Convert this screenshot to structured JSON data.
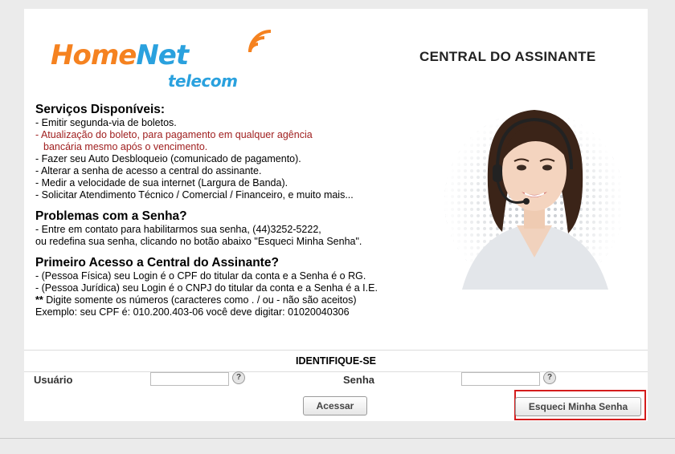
{
  "logo": {
    "word1": "Home",
    "word2": "Net",
    "sub": "telecom"
  },
  "header": {
    "title": "CENTRAL DO ASSINANTE"
  },
  "services": {
    "heading": "Serviços Disponíveis:",
    "items": [
      "- Emitir segunda-via de boletos.",
      "- Atualização do boleto, para pagamento em qualquer agência",
      "bancária mesmo após o vencimento.",
      "- Fazer seu Auto Desbloqueio (comunicado de pagamento).",
      "- Alterar a senha de acesso a central do assinante.",
      "- Medir a velocidade de sua internet (Largura de Banda).",
      "- Solicitar Atendimento Técnico / Comercial / Financeiro, e muito mais..."
    ]
  },
  "password_problems": {
    "heading": "Problemas com a Senha?",
    "lines": [
      "- Entre em contato para habilitarmos sua senha, (44)3252-5222,",
      "ou redefina sua senha, clicando no botão abaixo \"Esqueci Minha Senha\"."
    ]
  },
  "first_access": {
    "heading": "Primeiro Acesso a Central do Assinante?",
    "lines": [
      "- (Pessoa Física) seu Login é o CPF do titular da conta e a Senha é o RG.",
      "- (Pessoa Jurídica) seu Login é o CNPJ do titular da conta e a Senha é a I.E.",
      "Digite somente os números (caracteres como . / ou - não são aceitos)",
      "Exemplo: seu CPF é:  010.200.403-06  você deve digitar:  01020040306"
    ],
    "bullet_prefix": "**"
  },
  "login": {
    "section_title": "IDENTIFIQUE-SE",
    "user_label": "Usuário",
    "user_value": "",
    "password_label": "Senha",
    "password_value": "",
    "help_glyph": "?",
    "submit_label": "Acessar",
    "forgot_label": "Esqueci Minha Senha"
  },
  "colors": {
    "brand_orange": "#f58220",
    "brand_blue": "#2aa1de",
    "highlight_red": "#d41c1c",
    "notice_red": "#a02020"
  }
}
